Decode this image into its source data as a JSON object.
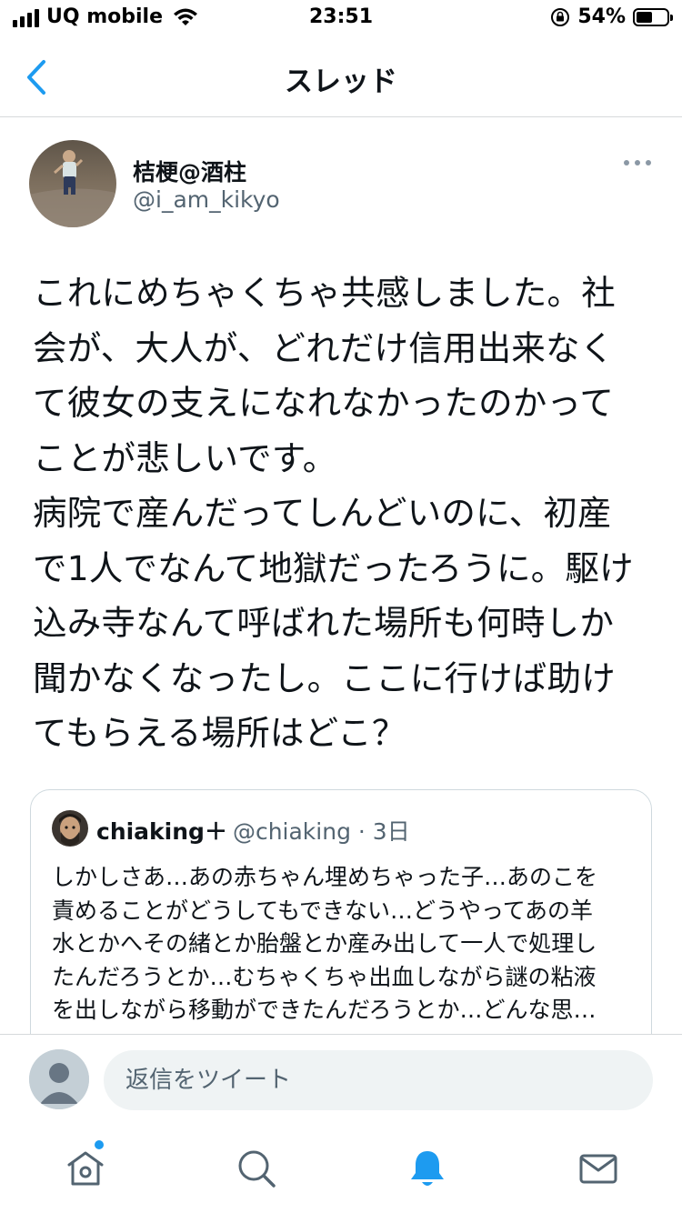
{
  "status_bar": {
    "carrier": "UQ mobile",
    "time": "23:51",
    "battery_percent": "54%",
    "battery_level": 0.54
  },
  "nav": {
    "title": "スレッド",
    "back_icon": "chevron-left-icon"
  },
  "tweet": {
    "display_name": "桔梗@酒柱",
    "handle": "@i_am_kikyo",
    "text_lines": [
      "これにめちゃくちゃ共感しました。社",
      "会が、大人が、どれだけ信用出来なく",
      "て彼女の支えになれなかったのかって",
      "ことが悲しいです。",
      "病院で産んだってしんどいのに、初産",
      "で1人でなんて地獄だったろうに。駆け",
      "込み寺なんて呼ばれた場所も何時しか",
      "聞かなくなったし。ここに行けば助け",
      "てもらえる場所はどこ？"
    ]
  },
  "quoted_tweet": {
    "display_name": "chiaking＋",
    "handle_time": "@chiaking · 3日",
    "text_lines": [
      "しかしさあ…あの赤ちゃん埋めちゃった子…あのこを",
      "責めることがどうしてもできない…どうやってあの羊",
      "水とかへその緒とか胎盤とか産み出して一人で処理し",
      "たんだろうとか…むちゃくちゃ出血しながら謎の粘液",
      "を出しながら移動ができたんだろうとか…どんな思…"
    ]
  },
  "reply": {
    "placeholder": "返信をツイート"
  },
  "tabs": [
    {
      "icon": "home-icon",
      "active": false,
      "has_dot": true
    },
    {
      "icon": "search-icon",
      "active": false
    },
    {
      "icon": "bell-icon",
      "active": true
    },
    {
      "icon": "mail-icon",
      "active": false
    }
  ],
  "colors": {
    "accent": "#1d9bf0",
    "text": "#0f1419",
    "secondary_text": "#536471",
    "border": "#cfd9de"
  }
}
